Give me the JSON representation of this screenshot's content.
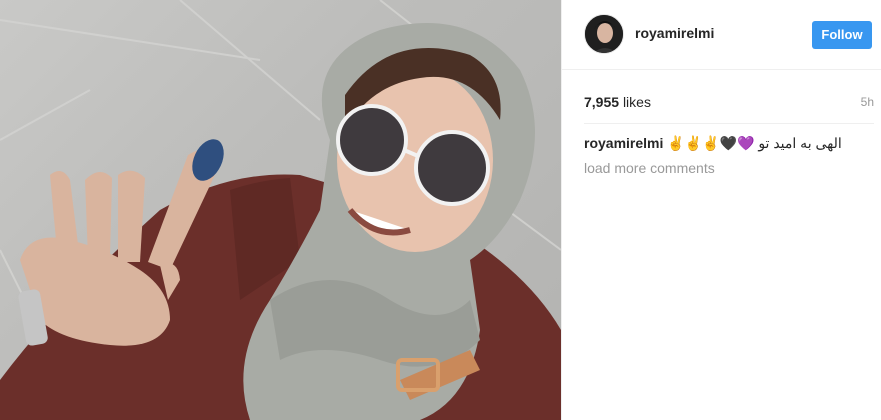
{
  "post": {
    "author": {
      "username": "royamirelmi"
    },
    "follow_label": "Follow",
    "likes": {
      "count": "7,955",
      "word": "likes"
    },
    "time_ago": "5h",
    "caption": {
      "username": "royamirelmi",
      "text": "الهی به امید تو 💜🖤✌✌✌"
    },
    "load_more_label": "load more comments"
  },
  "colors": {
    "follow_button": "#3897f0",
    "muted_text": "#999999",
    "primary_text": "#262626"
  }
}
